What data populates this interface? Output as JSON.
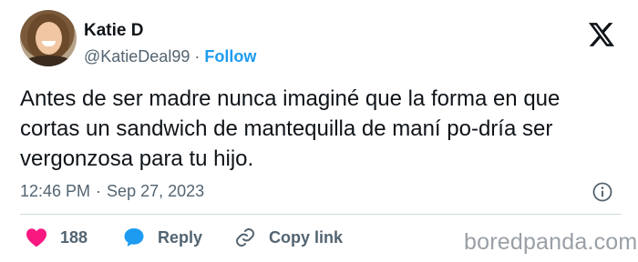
{
  "user": {
    "name": "Katie D",
    "handle": "@KatieDeal99",
    "separator": "·",
    "follow_label": "Follow"
  },
  "tweet": {
    "text": "Antes de ser madre nunca imaginé que la forma en que cortas un sandwich de mantequilla de maní po-dría ser vergonzosa para tu hijo.",
    "time": "12:46 PM",
    "separator": "·",
    "date": "Sep 27, 2023"
  },
  "actions": {
    "likes_count": "188",
    "reply_label": "Reply",
    "copy_label": "Copy link"
  },
  "watermark": "boredpanda.com",
  "icons": {
    "logo": "x-logo-icon",
    "info": "info-icon",
    "like": "heart-icon",
    "reply": "speech-bubble-icon",
    "copy": "link-icon"
  },
  "colors": {
    "text": "#0f1419",
    "secondary": "#536471",
    "accent": "#1d9bf0",
    "like": "#f91880",
    "watermark": "#9aa0a6"
  }
}
